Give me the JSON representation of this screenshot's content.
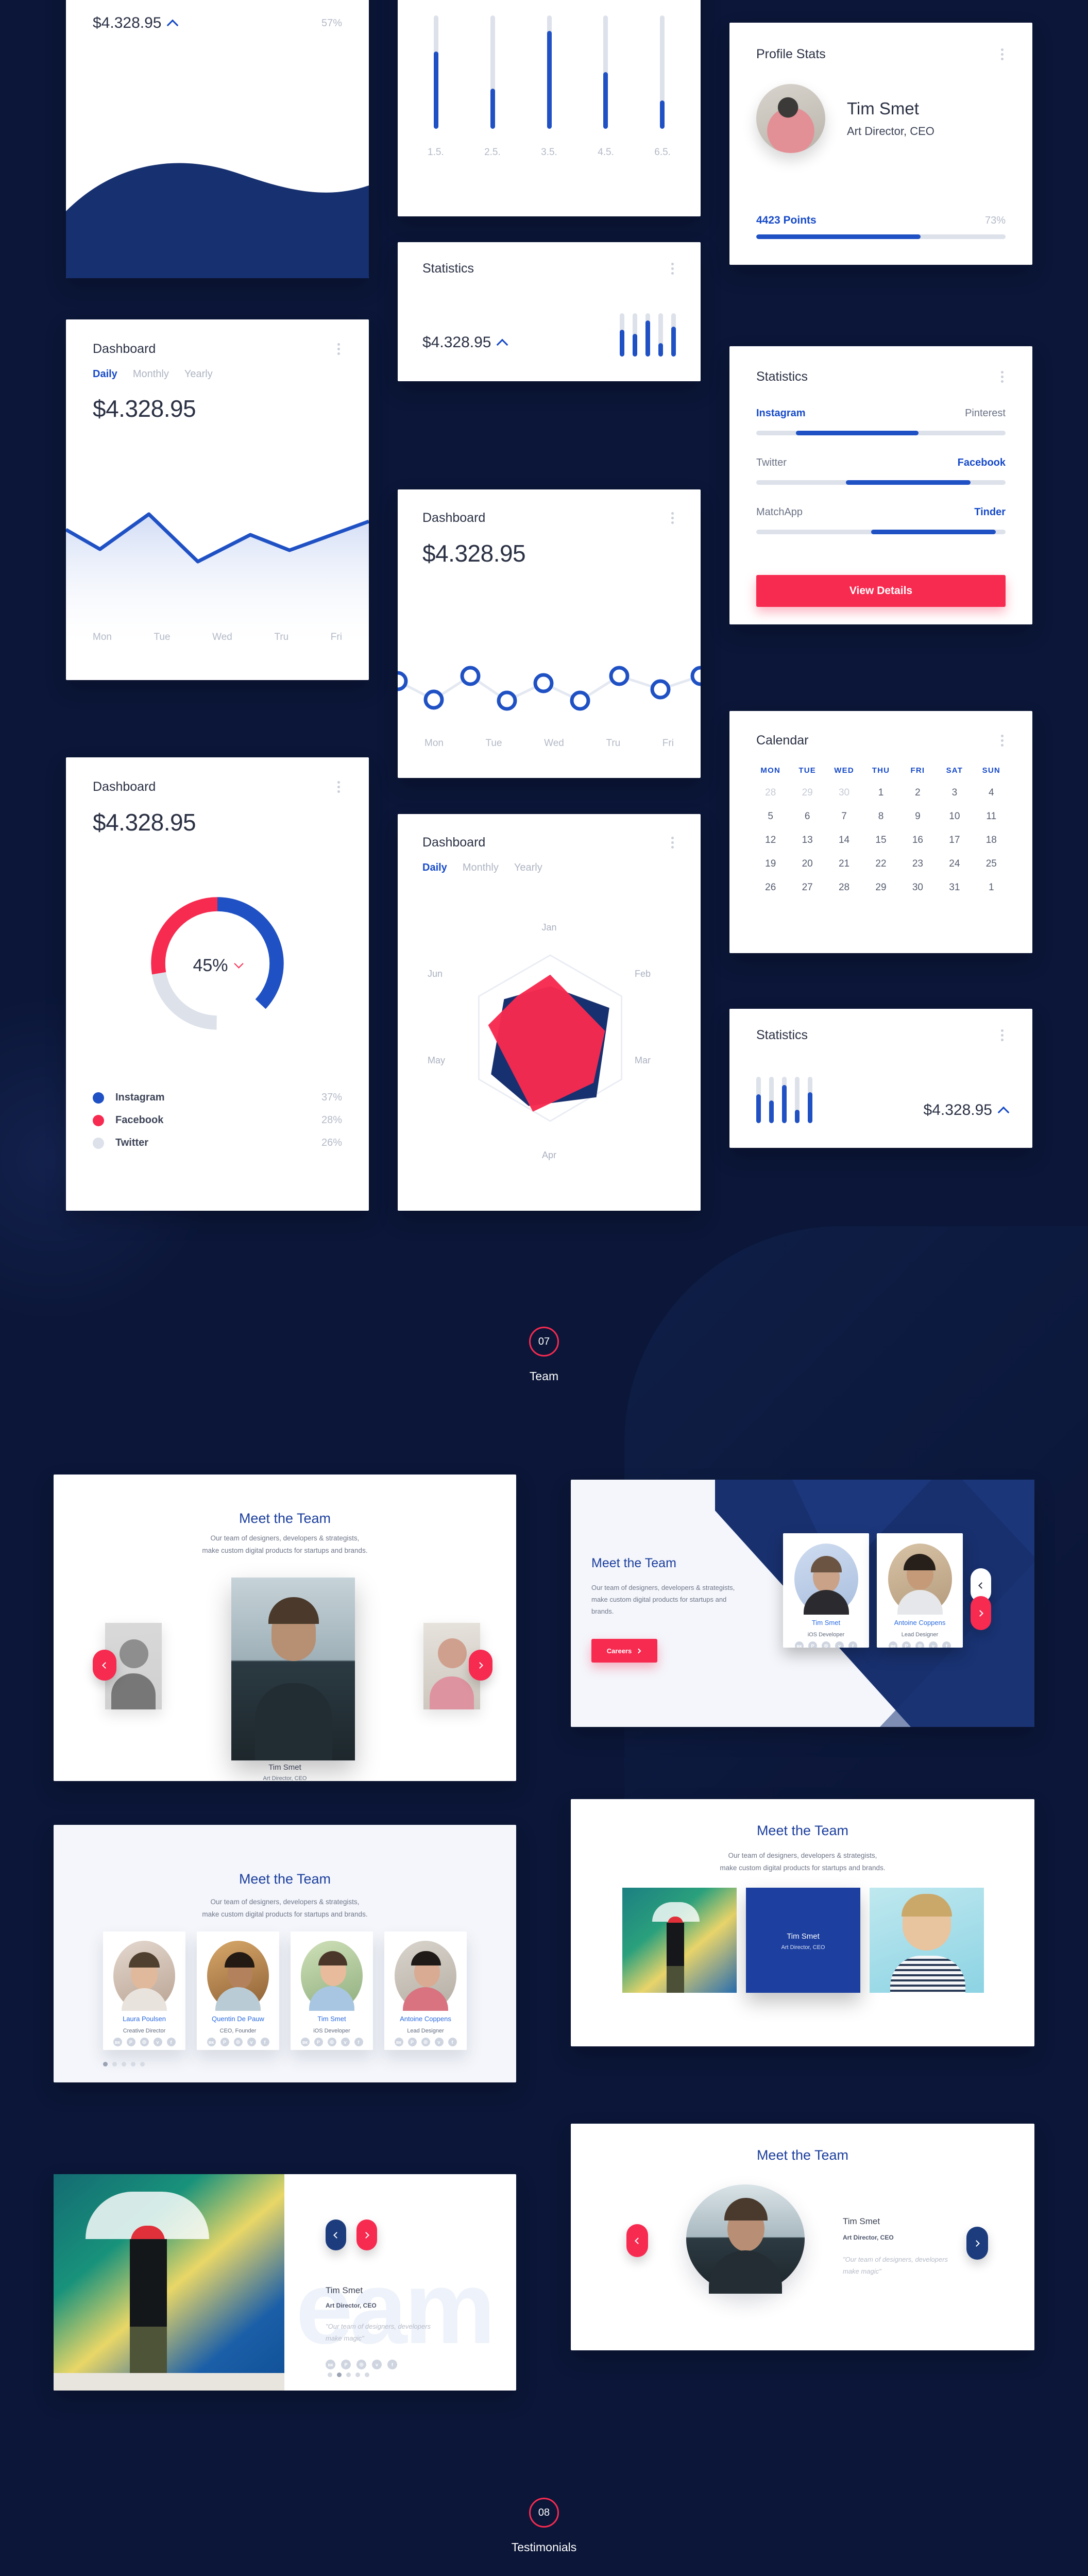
{
  "theme": {
    "bg": "#0b1638",
    "blue": "#1f51c4",
    "deep_blue": "#17306f",
    "red": "#f72a50",
    "navy_text": "#2b3144"
  },
  "cards": {
    "wave": {
      "amount": "$4.328.95",
      "pct": "57%",
      "trend_icon": "caret-up-icon"
    },
    "area_dashboard": {
      "title": "Dashboard",
      "tabs": [
        "Daily",
        "Monthly",
        "Yearly"
      ],
      "active_tab": "Daily",
      "amount": "$4.328.95",
      "xlabels": [
        "Mon",
        "Tue",
        "Wed",
        "Tru",
        "Fri"
      ]
    },
    "donut_dashboard": {
      "title": "Dashboard",
      "amount": "$4.328.95",
      "center_value": "45%",
      "legend": [
        {
          "name": "Instagram",
          "value": "37%",
          "color": "#1f51c4"
        },
        {
          "name": "Facebook",
          "value": "28%",
          "color": "#f72a50"
        },
        {
          "name": "Twitter",
          "value": "26%",
          "color": "#dde1ea"
        }
      ]
    },
    "range_bars": {
      "xlabels": [
        "1.5.",
        "2.5.",
        "3.5.",
        "4.5.",
        "6.5."
      ]
    },
    "stats_mini": {
      "title": "Statistics",
      "amount": "$4.328.95",
      "trend_icon": "caret-up-icon"
    },
    "scatter_dashboard": {
      "title": "Dashboard",
      "amount": "$4.328.95",
      "xlabels": [
        "Mon",
        "Tue",
        "Wed",
        "Tru",
        "Fri"
      ]
    },
    "radar_dashboard": {
      "title": "Dashboard",
      "tabs": [
        "Daily",
        "Monthly",
        "Yearly"
      ],
      "active_tab": "Daily",
      "axes": [
        "Jan",
        "Feb",
        "Mar",
        "Apr",
        "May",
        "Jun"
      ]
    },
    "profile_stats": {
      "title": "Profile Stats",
      "name": "Tim Smet",
      "role": "Art Director, CEO",
      "points_label": "4423 Points",
      "pct": "73%",
      "progress": 73
    },
    "social_stats": {
      "title": "Statistics",
      "rows": [
        {
          "left": "Instagram",
          "right": "Pinterest",
          "active": "left",
          "start": 16,
          "end": 65
        },
        {
          "left": "Twitter",
          "right": "Facebook",
          "active": "right",
          "start": 36,
          "end": 86
        },
        {
          "left": "MatchApp",
          "right": "Tinder",
          "active": "right",
          "start": 46,
          "end": 96
        }
      ],
      "button": "View Details"
    },
    "calendar": {
      "title": "Calendar",
      "weekdays": [
        "MON",
        "TUE",
        "WED",
        "THU",
        "FRI",
        "SAT",
        "SUN"
      ],
      "weeks": [
        [
          {
            "d": "28",
            "mute": true
          },
          {
            "d": "29",
            "mute": true
          },
          {
            "d": "30",
            "mute": true
          },
          {
            "d": "1"
          },
          {
            "d": "2"
          },
          {
            "d": "3"
          },
          {
            "d": "4"
          }
        ],
        [
          {
            "d": "5"
          },
          {
            "d": "6"
          },
          {
            "d": "7"
          },
          {
            "d": "8"
          },
          {
            "d": "9"
          },
          {
            "d": "10"
          },
          {
            "d": "11"
          }
        ],
        [
          {
            "d": "12"
          },
          {
            "d": "13"
          },
          {
            "d": "14"
          },
          {
            "d": "15"
          },
          {
            "d": "16"
          },
          {
            "d": "17"
          },
          {
            "d": "18"
          }
        ],
        [
          {
            "d": "19"
          },
          {
            "d": "20"
          },
          {
            "d": "21"
          },
          {
            "d": "22"
          },
          {
            "d": "23"
          },
          {
            "d": "24"
          },
          {
            "d": "25"
          }
        ],
        [
          {
            "d": "26"
          },
          {
            "d": "27"
          },
          {
            "d": "28"
          },
          {
            "d": "29"
          },
          {
            "d": "30"
          },
          {
            "d": "31"
          },
          {
            "d": "1"
          }
        ]
      ]
    },
    "stats_bottom": {
      "title": "Statistics",
      "amount": "$4.328.95",
      "trend_icon": "caret-up-icon"
    }
  },
  "sections": {
    "team": {
      "number": "07",
      "name": "Team"
    },
    "testimonials": {
      "number": "08",
      "name": "Testimonials"
    }
  },
  "team_common": {
    "heading": "Meet the Team",
    "sub_line1": "Our team of designers, developers & strategists,",
    "sub_line2": "make custom digital products for startups and brands.",
    "sub_wrapped": "Our team of designers, developers & strategists, make custom digital products for startups and brands.",
    "quote": "\"Our team of designers, developers make magic\"",
    "careers_label": "Careers",
    "social_icons": [
      "vk-icon",
      "pinterest-icon",
      "instagram-icon",
      "twitter-icon",
      "facebook-icon"
    ],
    "social_glyphs": [
      "вк",
      "P",
      "◎",
      "ᴠ",
      "f"
    ]
  },
  "team_carousel": {
    "name": "Tim Smet",
    "role": "Art Director, CEO"
  },
  "team_blue_panel": {
    "members": [
      {
        "name": "Tim Smet",
        "role": "iOS Developer"
      },
      {
        "name": "Antoine Coppens",
        "role": "Lead Designer"
      }
    ]
  },
  "team_grid": {
    "members": [
      {
        "name": "Laura Poulsen",
        "role": "Creative Director"
      },
      {
        "name": "Quentin De Pauw",
        "role": "CEO, Founder"
      },
      {
        "name": "Tim Smet",
        "role": "iOS Developer"
      },
      {
        "name": "Antoine Coppens",
        "role": "Lead Designer"
      }
    ],
    "dots": 5,
    "active_dot": 1
  },
  "team_triple": {
    "overlay_name": "Tim Smet",
    "overlay_role": "Art Director, CEO"
  },
  "team_split": {
    "name": "Tim Smet",
    "role": "Art Director, CEO",
    "watermark": "eam",
    "dots": 5,
    "active_dot": 2
  },
  "team_oval": {
    "name": "Tim Smet",
    "role": "Art Director, CEO"
  }
}
